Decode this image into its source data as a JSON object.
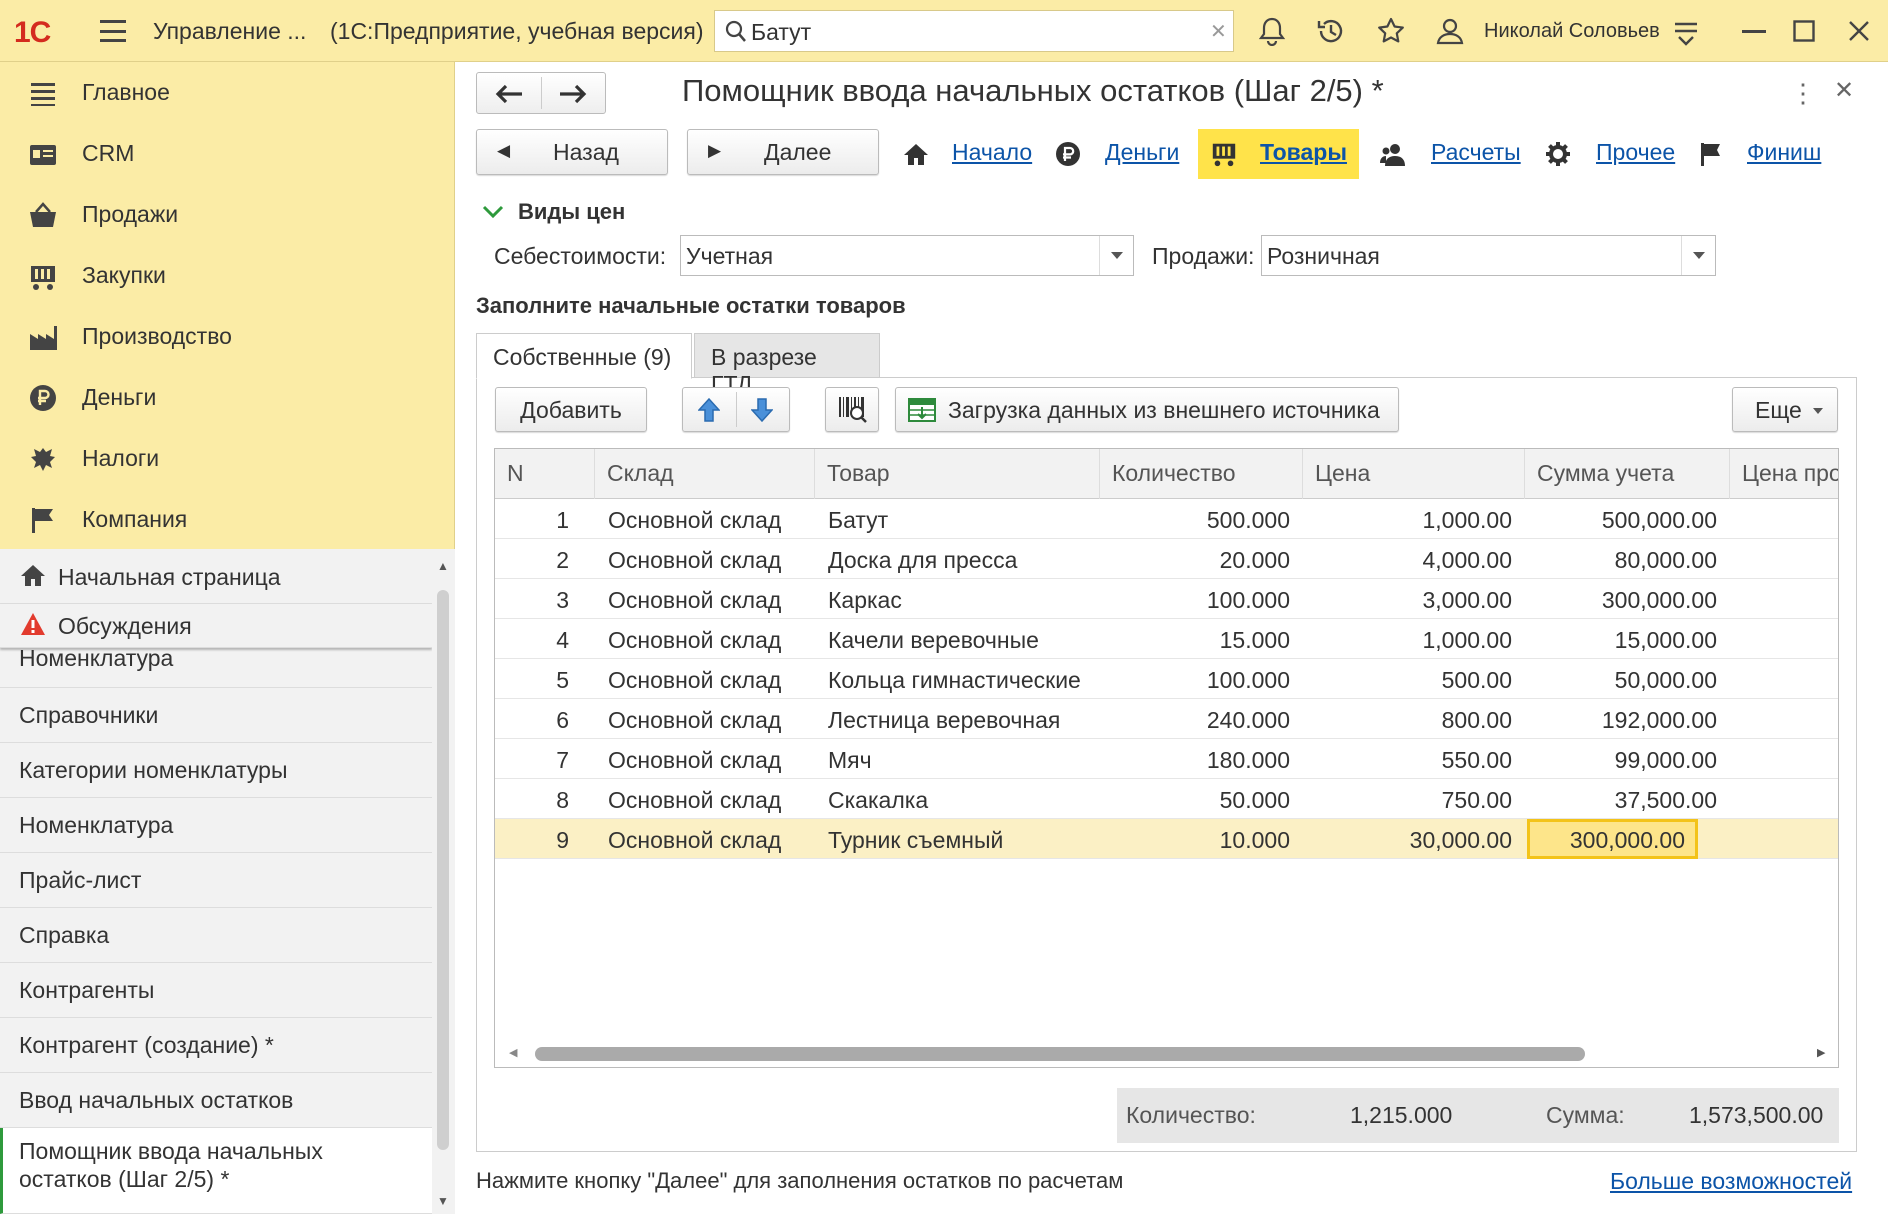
{
  "app": {
    "logo": "1С",
    "title": "Управление ...",
    "subtitle": "(1С:Предприятие, учебная версия)",
    "search_value": "Батут",
    "user": "Николай Соловьев"
  },
  "nav": [
    {
      "label": "Главное",
      "icon": "menu-icon"
    },
    {
      "label": "CRM",
      "icon": "crm-card-icon"
    },
    {
      "label": "Продажи",
      "icon": "basket-icon"
    },
    {
      "label": "Закупки",
      "icon": "cart-icon"
    },
    {
      "label": "Производство",
      "icon": "factory-icon"
    },
    {
      "label": "Деньги",
      "icon": "ruble-icon"
    },
    {
      "label": "Налоги",
      "icon": "eagle-icon"
    },
    {
      "label": "Компания",
      "icon": "flag-icon"
    }
  ],
  "history": {
    "home": "Начальная страница",
    "discussions": "Обсуждения",
    "items": [
      "Номенклатура",
      "Справочники",
      "Категории номенклатуры",
      "Номенклатура",
      "Прайс-лист",
      "Справка",
      "Контрагенты",
      "Контрагент (создание) *",
      "Ввод начальных остатков",
      "Помощник ввода начальных",
      "остатков (Шаг 2/5) *"
    ]
  },
  "form": {
    "title": "Помощник ввода начальных остатков (Шаг 2/5) *",
    "back": "Назад",
    "next": "Далее",
    "steps": [
      "Начало",
      "Деньги",
      "Товары",
      "Расчеты",
      "Прочее",
      "Финиш"
    ],
    "active_step": "Товары",
    "prices_header": "Виды цен",
    "cost_label": "Себестоимости:",
    "cost_value": "Учетная",
    "sales_label": "Продажи:",
    "sales_value": "Розничная",
    "fill_header": "Заполните начальные остатки товаров",
    "tabs": [
      "Собственные (9)",
      "В разрезе ГТД"
    ],
    "toolbar": {
      "add": "Добавить",
      "load": "Загрузка данных из внешнего источника",
      "more": "Еще"
    },
    "columns": [
      "N",
      "Склад",
      "Товар",
      "Количество",
      "Цена",
      "Сумма учета",
      "Цена про"
    ],
    "rows": [
      {
        "n": "1",
        "sklad": "Основной склад",
        "tovar": "Батут",
        "qty": "500.000",
        "price": "1,000.00",
        "sum": "500,000.00"
      },
      {
        "n": "2",
        "sklad": "Основной склад",
        "tovar": "Доска для пресса",
        "qty": "20.000",
        "price": "4,000.00",
        "sum": "80,000.00"
      },
      {
        "n": "3",
        "sklad": "Основной склад",
        "tovar": "Каркас",
        "qty": "100.000",
        "price": "3,000.00",
        "sum": "300,000.00"
      },
      {
        "n": "4",
        "sklad": "Основной склад",
        "tovar": "Качели веревочные",
        "qty": "15.000",
        "price": "1,000.00",
        "sum": "15,000.00"
      },
      {
        "n": "5",
        "sklad": "Основной склад",
        "tovar": "Кольца гимнастические",
        "qty": "100.000",
        "price": "500.00",
        "sum": "50,000.00"
      },
      {
        "n": "6",
        "sklad": "Основной склад",
        "tovar": "Лестница веревочная",
        "qty": "240.000",
        "price": "800.00",
        "sum": "192,000.00"
      },
      {
        "n": "7",
        "sklad": "Основной склад",
        "tovar": "Мяч",
        "qty": "180.000",
        "price": "550.00",
        "sum": "99,000.00"
      },
      {
        "n": "8",
        "sklad": "Основной склад",
        "tovar": "Скакалка",
        "qty": "50.000",
        "price": "750.00",
        "sum": "37,500.00"
      },
      {
        "n": "9",
        "sklad": "Основной склад",
        "tovar": "Турник съемный",
        "qty": "10.000",
        "price": "30,000.00",
        "sum": "300,000.00"
      }
    ],
    "totals": {
      "qty_label": "Количество:",
      "qty_value": "1,215.000",
      "sum_label": "Сумма:",
      "sum_value": "1,573,500.00"
    },
    "hint": "Нажмите кнопку \"Далее\" для заполнения остатков по расчетам",
    "more_link": "Больше возможностей"
  },
  "colors": {
    "accent_yellow": "#fbeca6",
    "active_step": "#ffe34a",
    "link": "#0c54a8",
    "logo_red": "#d42b1e"
  }
}
